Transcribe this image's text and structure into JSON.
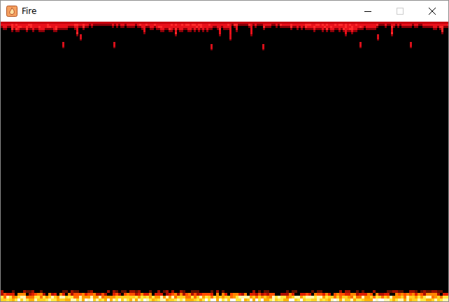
{
  "window": {
    "title": "Fire",
    "controls": [
      {
        "kind": "minimize",
        "disabled": false
      },
      {
        "kind": "maximize",
        "disabled": true
      },
      {
        "kind": "close",
        "disabled": false
      }
    ]
  }
}
